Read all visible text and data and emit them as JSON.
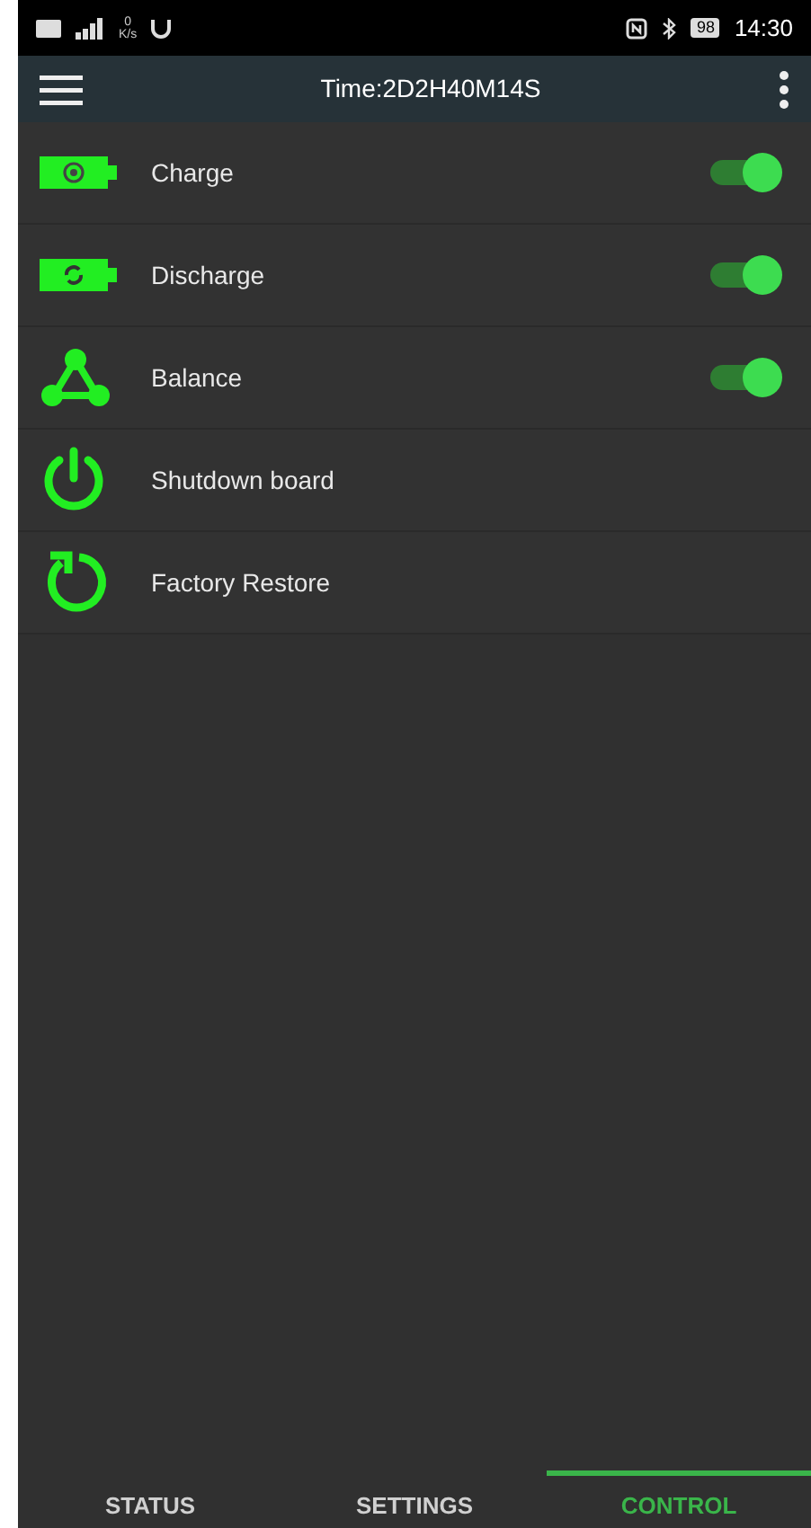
{
  "status_bar": {
    "net_speed_value": "0",
    "net_speed_unit": "K/s",
    "battery": "98",
    "time": "14:30"
  },
  "app_bar": {
    "title": "Time:2D2H40M14S"
  },
  "items": [
    {
      "kind": "toggle",
      "label": "Charge",
      "on": true
    },
    {
      "kind": "toggle",
      "label": "Discharge",
      "on": true
    },
    {
      "kind": "toggle",
      "label": "Balance",
      "on": true
    },
    {
      "kind": "action",
      "label": "Shutdown board"
    },
    {
      "kind": "action",
      "label": "Factory Restore"
    }
  ],
  "tabs": [
    {
      "label": "STATUS",
      "selected": false
    },
    {
      "label": "SETTINGS",
      "selected": false
    },
    {
      "label": "CONTROL",
      "selected": true
    }
  ]
}
